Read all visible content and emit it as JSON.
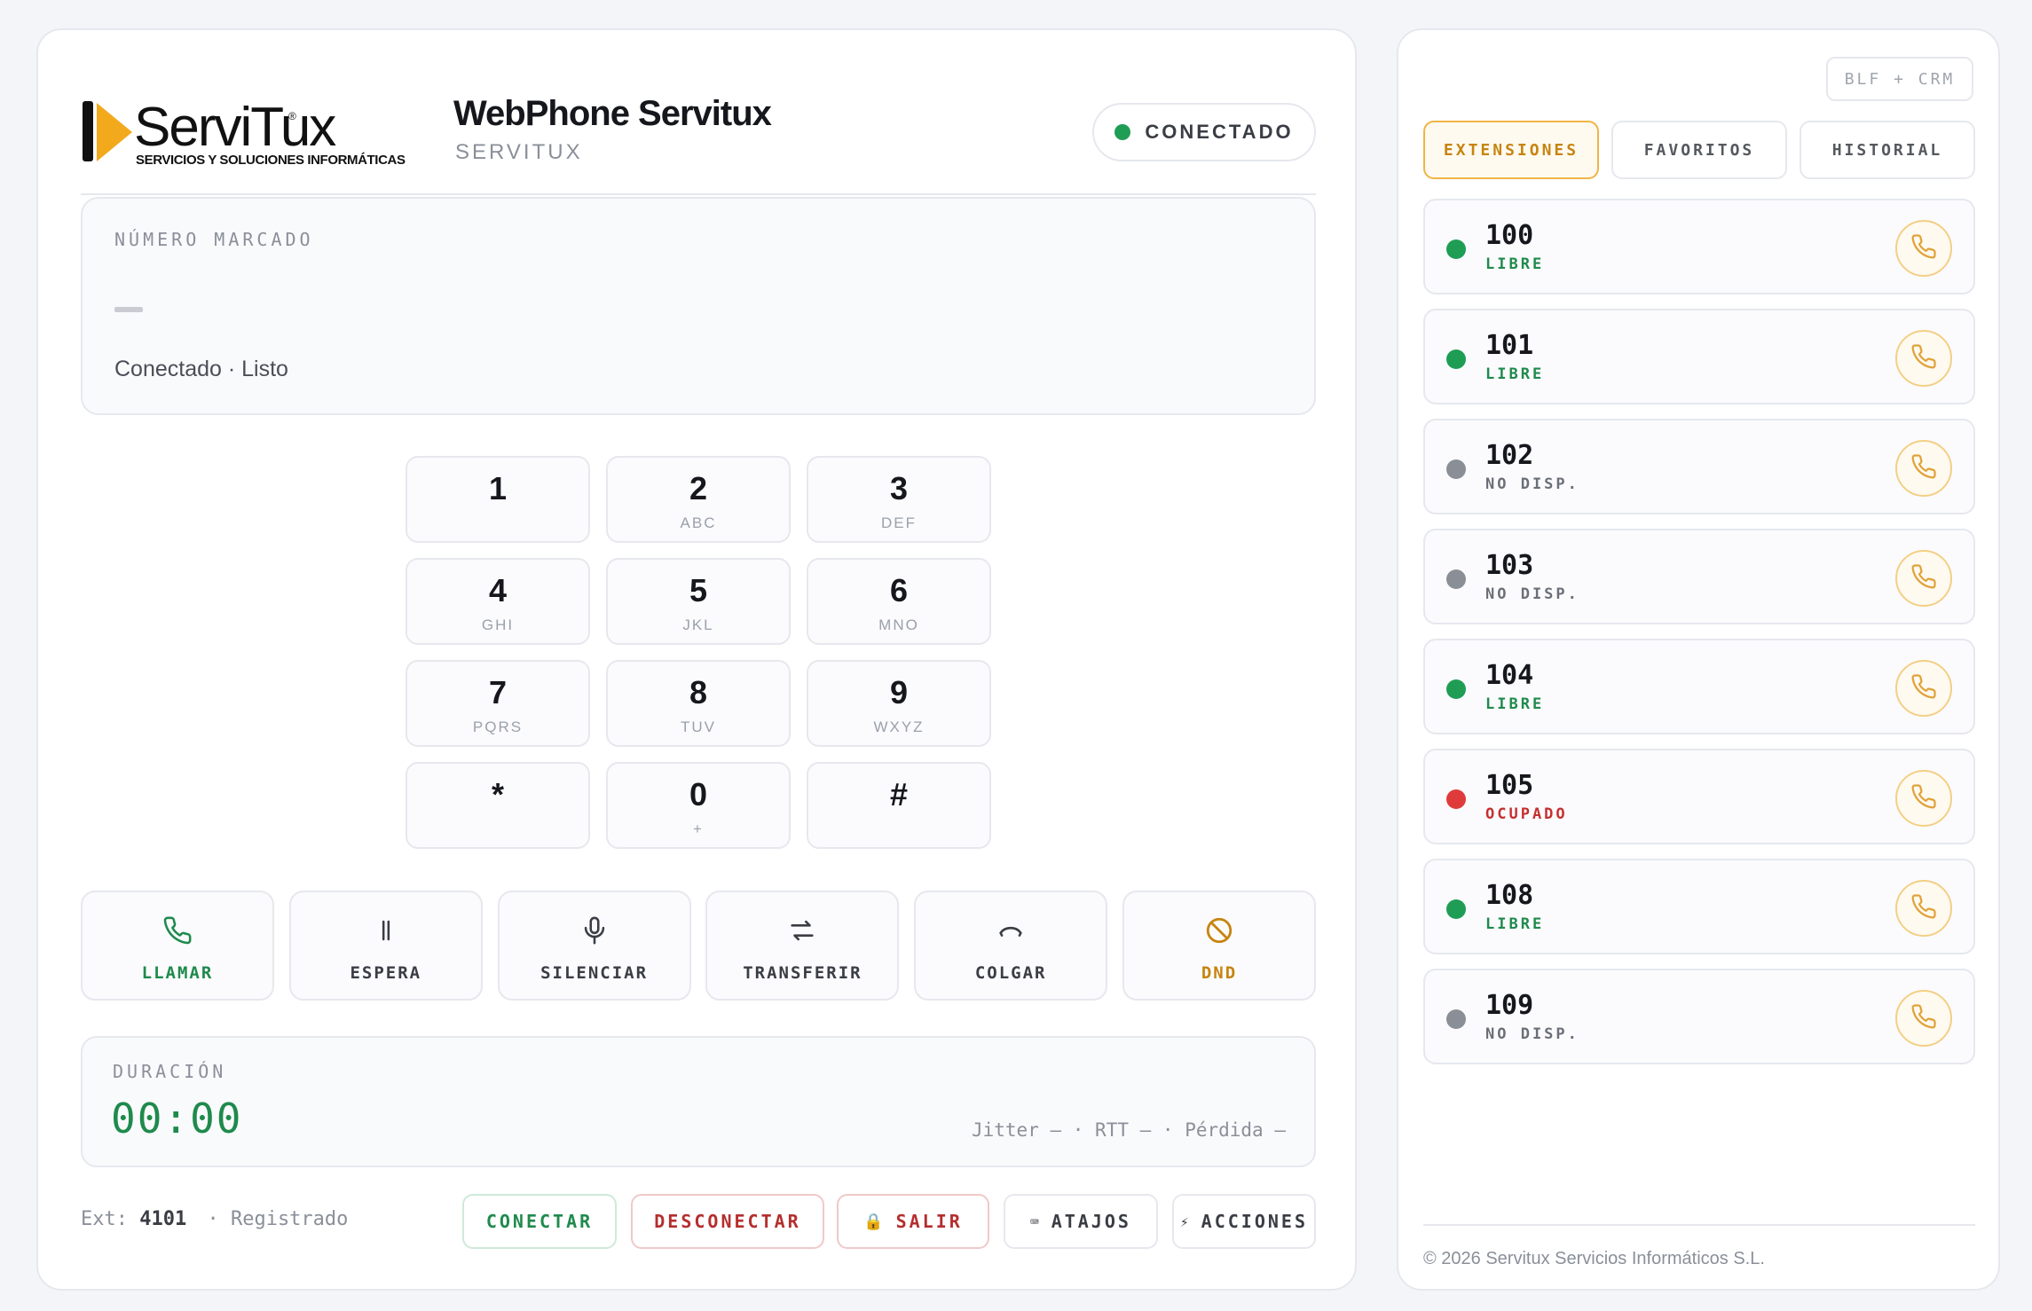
{
  "header": {
    "logo_brand": "ServiTux",
    "logo_tagline": "SERVICIOS Y SOLUCIONES INFORMÁTICAS",
    "title": "WebPhone Servitux",
    "subtitle": "SERVITUX",
    "status": "CONECTADO",
    "status_color": "#1f9d55"
  },
  "display": {
    "caption": "NÚMERO MARCADO",
    "number": "",
    "state_text": "Conectado · Listo"
  },
  "keypad": [
    {
      "digit": "1",
      "letters": ""
    },
    {
      "digit": "2",
      "letters": "ABC"
    },
    {
      "digit": "3",
      "letters": "DEF"
    },
    {
      "digit": "4",
      "letters": "GHI"
    },
    {
      "digit": "5",
      "letters": "JKL"
    },
    {
      "digit": "6",
      "letters": "MNO"
    },
    {
      "digit": "7",
      "letters": "PQRS"
    },
    {
      "digit": "8",
      "letters": "TUV"
    },
    {
      "digit": "9",
      "letters": "WXYZ"
    },
    {
      "digit": "*",
      "letters": ""
    },
    {
      "digit": "0",
      "letters": "+"
    },
    {
      "digit": "#",
      "letters": ""
    }
  ],
  "actions": [
    {
      "label": "LLAMAR",
      "icon": "phone-icon",
      "color": "#1f8a4c"
    },
    {
      "label": "ESPERA",
      "icon": "pause-icon",
      "color": "#3a3d44"
    },
    {
      "label": "SILENCIAR",
      "icon": "microphone-icon",
      "color": "#3a3d44"
    },
    {
      "label": "TRANSFERIR",
      "icon": "transfer-icon",
      "color": "#3a3d44"
    },
    {
      "label": "COLGAR",
      "icon": "hangup-icon",
      "color": "#3a3d44"
    },
    {
      "label": "DND",
      "icon": "do-not-disturb-icon",
      "color": "#c78410"
    }
  ],
  "duration": {
    "caption": "DURACIÓN",
    "timer": "00:00",
    "stats": "Jitter — · RTT — · Pérdida —"
  },
  "footer": {
    "ext_label": "Ext:",
    "ext_number": "4101",
    "ext_status": "· Registrado",
    "buttons": {
      "connect": "CONECTAR",
      "disconnect": "DESCONECTAR",
      "logout": "SALIR",
      "logout_glyph": "🔒",
      "shortcuts": "ATAJOS",
      "shortcuts_glyph": "⌨",
      "actions": "ACCIONES",
      "actions_glyph": "⚡"
    }
  },
  "sidebar": {
    "badge": "BLF + CRM",
    "tabs": [
      "EXTENSIONES",
      "FAVORITOS",
      "HISTORIAL"
    ],
    "active_tab": "EXTENSIONES",
    "extensions": [
      {
        "number": "100",
        "status": "LIBRE",
        "color": "#1f9d55"
      },
      {
        "number": "101",
        "status": "LIBRE",
        "color": "#1f9d55"
      },
      {
        "number": "102",
        "status": "NO DISP.",
        "color": "#8a8e96"
      },
      {
        "number": "103",
        "status": "NO DISP.",
        "color": "#8a8e96"
      },
      {
        "number": "104",
        "status": "LIBRE",
        "color": "#1f9d55"
      },
      {
        "number": "105",
        "status": "OCUPADO",
        "color": "#e03b3b"
      },
      {
        "number": "108",
        "status": "LIBRE",
        "color": "#1f9d55"
      },
      {
        "number": "109",
        "status": "NO DISP.",
        "color": "#8a8e96"
      }
    ],
    "copyright": "© 2026 Servitux Servicios Informáticos S.L."
  },
  "colors": {
    "accent": "#f3a91c",
    "success": "#1f8a4c",
    "danger": "#b52e2e"
  }
}
